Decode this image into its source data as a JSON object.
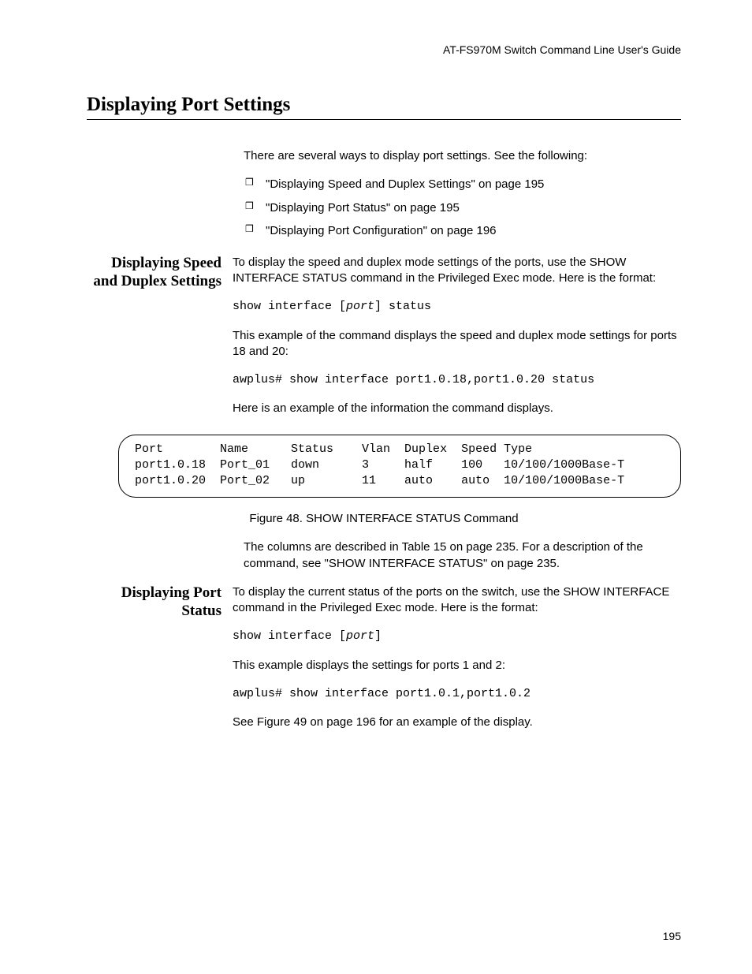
{
  "header": "AT-FS970M Switch Command Line User's Guide",
  "title": "Displaying Port Settings",
  "intro": "There are several ways to display port settings. See the following:",
  "bullets": [
    "\"Displaying Speed and Duplex Settings\" on page 195",
    "\"Displaying Port Status\" on page 195",
    "\"Displaying Port Configuration\" on page 196"
  ],
  "sec1": {
    "heading": "Displaying Speed and Duplex Settings",
    "p1": "To display the speed and duplex mode settings of the ports, use the SHOW INTERFACE STATUS command in the Privileged Exec mode. Here is the format:",
    "cmd_pre": "show interface [",
    "cmd_var": "port",
    "cmd_post": "] status",
    "p2": "This example of the command displays the speed and duplex mode settings for ports 18 and 20:",
    "example": "awplus# show interface port1.0.18,port1.0.20 status",
    "p3": "Here is an example of the information the command displays.",
    "output": "Port        Name      Status    Vlan  Duplex  Speed Type\nport1.0.18  Port_01   down      3     half    100   10/100/1000Base-T\nport1.0.20  Port_02   up        11    auto    auto  10/100/1000Base-T",
    "caption": "Figure 48. SHOW INTERFACE STATUS Command",
    "postnote": "The columns are described in Table 15 on page 235. For a description of the command, see \"SHOW INTERFACE STATUS\" on page 235."
  },
  "sec2": {
    "heading": "Displaying Port Status",
    "p1": "To display the current status of the ports on the switch, use the SHOW INTERFACE command in the Privileged Exec mode. Here is the format:",
    "cmd_pre": "show interface [",
    "cmd_var": "port",
    "cmd_post": "]",
    "p2": "This example displays the settings for ports 1 and 2:",
    "example": "awplus# show interface port1.0.1,port1.0.2",
    "p3": "See Figure 49 on page 196 for an example of the display."
  },
  "pagenum": "195"
}
